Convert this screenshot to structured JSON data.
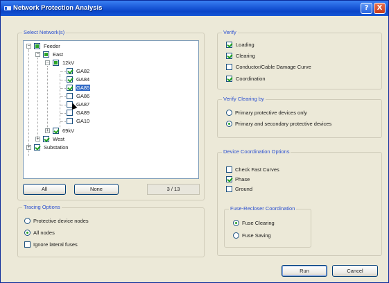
{
  "window": {
    "title": "Network Protection Analysis",
    "help_label": "?",
    "close_label": "X"
  },
  "select_network": {
    "legend": "Select Network(s)",
    "tree": {
      "feeder": "Feeder",
      "east": "East",
      "kv12": "12kV",
      "items": [
        "GA82",
        "GA84",
        "GA85",
        "GA86",
        "GA87",
        "GA89",
        "GA10"
      ],
      "selected_item": "GA85",
      "kv69": "69kV",
      "west": "West",
      "substation": "Substation"
    },
    "all_button": "All",
    "none_button": "None",
    "count": "3 / 13"
  },
  "tracing": {
    "legend": "Tracing Options",
    "protective_nodes": "Protective device nodes",
    "all_nodes": "All nodes",
    "ignore_lateral": "Ignore lateral fuses"
  },
  "verify": {
    "legend": "Verify",
    "loading": "Loading",
    "clearing": "Clearing",
    "damage_curve": "Conductor/Cable Damage Curve",
    "coordination": "Coordination"
  },
  "verify_clearing": {
    "legend": "Verify Clearing by",
    "primary_only": "Primary protective devices only",
    "primary_secondary": "Primary and secondary protective devices"
  },
  "device_coordination": {
    "legend": "Device Coordination Options",
    "check_fast": "Check Fast Curves",
    "phase": "Phase",
    "ground": "Ground"
  },
  "fuse_recloser": {
    "legend": "Fuse-Recloser Coordination",
    "fuse_clearing": "Fuse Clearing",
    "fuse_saving": "Fuse Saving"
  },
  "actions": {
    "run": "Run",
    "cancel": "Cancel"
  }
}
